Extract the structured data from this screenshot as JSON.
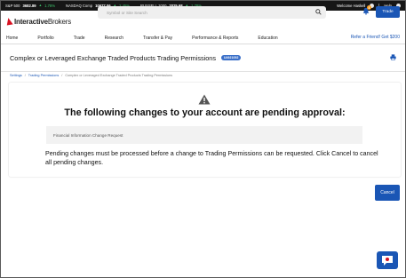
{
  "ticker": {
    "items": [
      {
        "name": "S&P 500",
        "value": "3682.89",
        "change": "1.78%"
      },
      {
        "name": "NASDAQ Comp",
        "value": "10677.06",
        "change": "2.45%"
      },
      {
        "name": "RUSSELL 1000",
        "value": "2025.68",
        "change": "1.78%"
      }
    ],
    "welcome": "Welcome Haskell",
    "help": "Help"
  },
  "header": {
    "logo_bold": "Interactive",
    "logo_regular": "Brokers",
    "search_placeholder": "Symbol or Site Search",
    "notification_count": "3",
    "trade_label": "Trade"
  },
  "nav": {
    "items": [
      "Home",
      "Portfolio",
      "Trade",
      "Research",
      "Transfer & Pay",
      "Performance & Reports",
      "Education"
    ],
    "refer": "Refer a Friend! Get $200"
  },
  "page": {
    "title": "Complex or Leveraged Exchange Traded Products Trading Permissions",
    "badge": "U4921052",
    "breadcrumb": [
      "Settings",
      "Trading Permissions",
      "Complex or Leveraged Exchange Traded Products Trading Permissions"
    ]
  },
  "card": {
    "headline": "The following changes to your account are pending approval:",
    "change_item": "Financial Information Change Request",
    "note": "Pending changes must be processed before a change to Trading Permissions can be requested. Click Cancel to cancel all pending changes."
  },
  "actions": {
    "cancel_label": "Cancel"
  },
  "colors": {
    "accent": "#1a56b5",
    "brand_red": "#d81222",
    "positive": "#3ec46d",
    "ticker_bg": "#161616"
  }
}
